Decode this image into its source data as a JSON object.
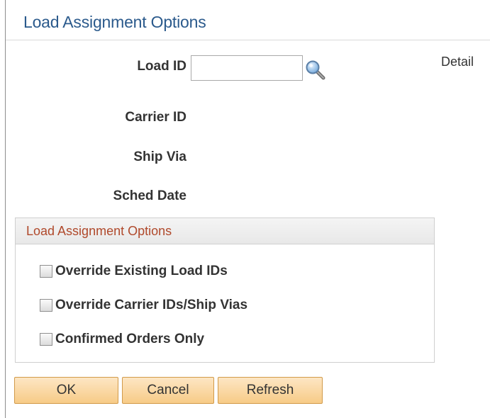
{
  "header": {
    "title": "Load Assignment Options"
  },
  "fields": {
    "load_id_label": "Load ID",
    "load_id_value": "",
    "carrier_id_label": "Carrier ID",
    "ship_via_label": "Ship Via",
    "sched_date_label": "Sched Date",
    "detail_link": "Detail"
  },
  "options_group": {
    "title": "Load Assignment Options",
    "checkboxes": [
      {
        "label": "Override Existing Load IDs",
        "checked": false
      },
      {
        "label": "Override Carrier IDs/Ship Vias",
        "checked": false
      },
      {
        "label": "Confirmed Orders Only",
        "checked": false
      }
    ]
  },
  "buttons": {
    "ok": "OK",
    "cancel": "Cancel",
    "refresh": "Refresh"
  },
  "icons": {
    "lookup": "magnifier-icon"
  },
  "colors": {
    "title": "#2b5a8c",
    "group_title": "#b0492b",
    "button_fill": "#f7cb87",
    "button_border": "#d19a4a"
  }
}
